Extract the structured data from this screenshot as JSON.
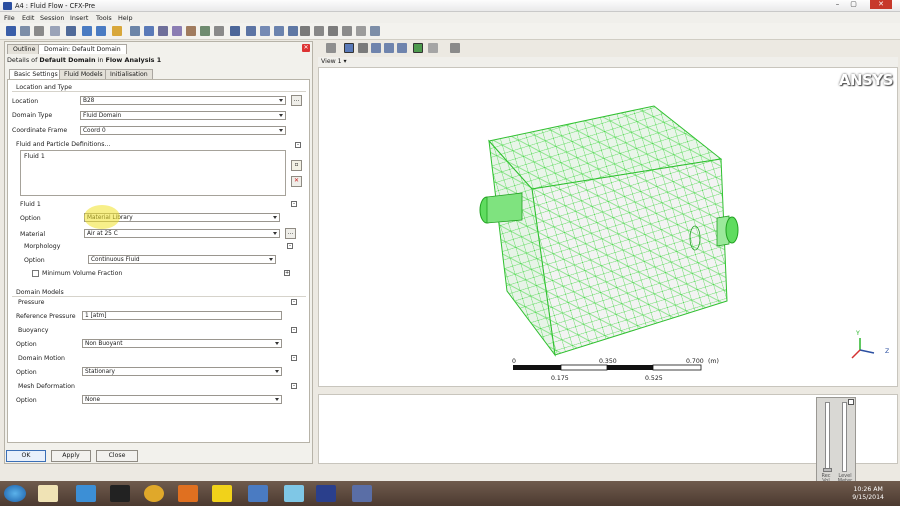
{
  "window": {
    "title": "A4 : Fluid Flow - CFX-Pre"
  },
  "menu": [
    "File",
    "Edit",
    "Session",
    "Insert",
    "Tools",
    "Help"
  ],
  "panel": {
    "tabs": [
      "Outline",
      "Domain: Default Domain"
    ],
    "details_title": "Details of Default Domain in Flow Analysis 1",
    "details_prefix": "Details of ",
    "details_domain": "Default Domain",
    "details_middle": " in ",
    "details_analysis": "Flow Analysis 1",
    "subtabs": [
      "Basic Settings",
      "Fluid Models",
      "Initialisation"
    ]
  },
  "form": {
    "location_and_type": "Location and Type",
    "location_label": "Location",
    "location_value": "B28",
    "domain_type_label": "Domain Type",
    "domain_type_value": "Fluid Domain",
    "coord_frame_label": "Coordinate Frame",
    "coord_frame_value": "Coord 0",
    "fluid_defs_label": "Fluid and Particle Definitions...",
    "fluid_list_item": "Fluid 1",
    "fluid1_header": "Fluid 1",
    "option_label": "Option",
    "option_value": "Material Library",
    "material_label": "Material",
    "material_value": "Air at 25 C",
    "morphology_label": "Morphology",
    "morph_option_label": "Option",
    "morph_option_value": "Continuous Fluid",
    "min_vol_fraction_label": "Minimum Volume Fraction",
    "domain_models_label": "Domain Models",
    "pressure_label": "Pressure",
    "ref_pressure_label": "Reference Pressure",
    "ref_pressure_value": "1 [atm]",
    "buoyancy_label": "Buoyancy",
    "buoyancy_option_label": "Option",
    "buoyancy_option_value": "Non Buoyant",
    "domain_motion_label": "Domain Motion",
    "motion_option_label": "Option",
    "motion_option_value": "Stationary",
    "mesh_deformation_label": "Mesh Deformation",
    "mesh_option_label": "Option",
    "mesh_option_value": "None",
    "dots": "..."
  },
  "buttons": {
    "ok": "OK",
    "apply": "Apply",
    "close": "Close"
  },
  "viewer": {
    "view_label": "View 1 ▾",
    "logo": "ANSYS",
    "scale_ticks_top": [
      "0",
      "0.350",
      "0.700"
    ],
    "scale_unit": "(m)",
    "scale_ticks_bottom": [
      "0.175",
      "0.525"
    ],
    "axis_y": "Y",
    "axis_z": "Z"
  },
  "lower_panel": {
    "rec_label": "Rec Vol",
    "level_label": "Level Meter"
  },
  "taskbar": {
    "time": "10:26 AM",
    "date": "9/15/2014"
  },
  "colors": {
    "mesh_green": "#35d535",
    "accent_blue": "#2b4fa1"
  }
}
